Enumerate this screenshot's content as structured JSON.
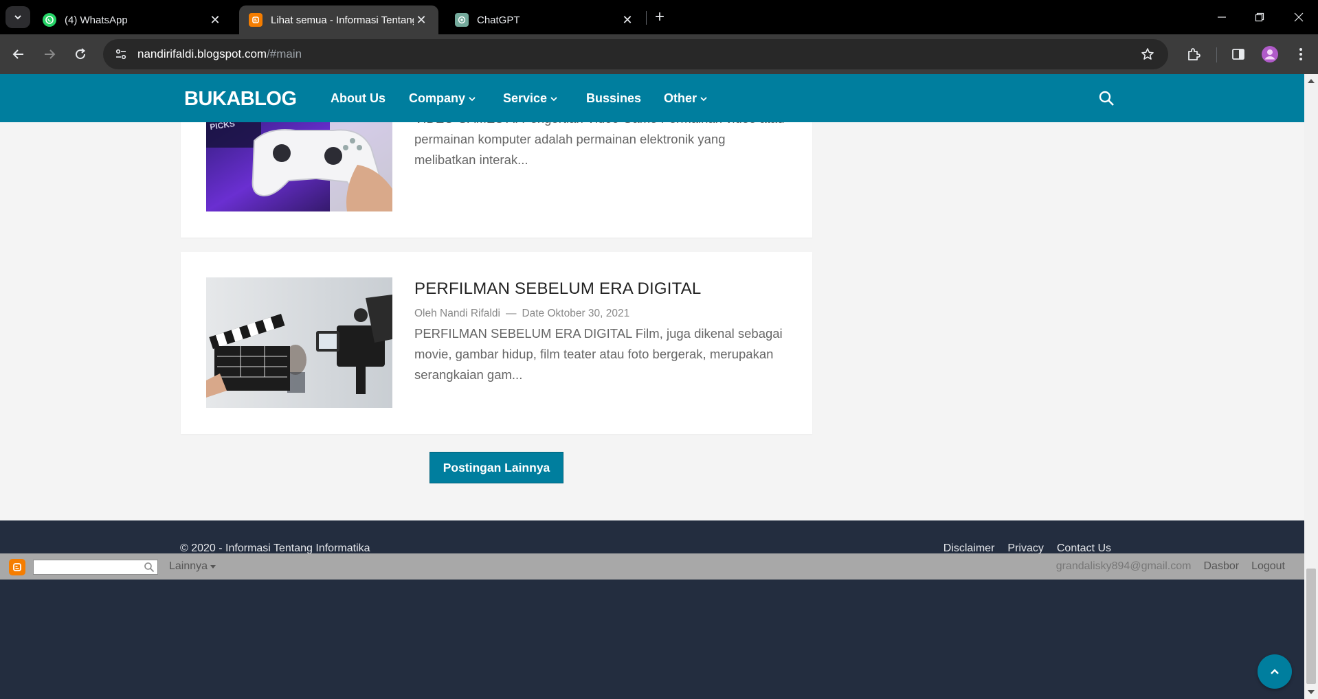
{
  "browser": {
    "tabs": [
      {
        "title": "(4) WhatsApp",
        "icon": "whatsapp-icon"
      },
      {
        "title": "Lihat semua - Informasi Tentang",
        "icon": "blogger-icon",
        "active": true
      },
      {
        "title": "ChatGPT",
        "icon": "chatgpt-icon"
      }
    ],
    "url_host": "nandirifaldi.blogspot.com",
    "url_path": "/#main"
  },
  "site": {
    "logo": "BUKABLOG",
    "nav": [
      {
        "label": "About Us",
        "dropdown": false
      },
      {
        "label": "Company",
        "dropdown": true
      },
      {
        "label": "Service",
        "dropdown": true
      },
      {
        "label": "Bussines",
        "dropdown": false
      },
      {
        "label": "Other",
        "dropdown": true
      }
    ],
    "accent_color": "#007e9e"
  },
  "posts": [
    {
      "title": "",
      "excerpt": "VIDEO GAMES   A.   Pengertian Video Game Permainan video atau permainan komputer adalah permainan elektronik yang melibatkan interak..."
    },
    {
      "title": "PERFILMAN SEBELUM ERA DIGITAL",
      "author": "Oleh Nandi Rifaldi",
      "separator": "—",
      "date": "Date Oktober 30, 2021",
      "excerpt": "PERFILMAN SEBELUM ERA DIGITAL Film, juga dikenal sebagai movie, gambar hidup, film teater atau foto bergerak, merupakan serangkaian gam..."
    }
  ],
  "more_button": "Postingan Lainnya",
  "footer": {
    "copyright": "© 2020 - Informasi Tentang Informatika",
    "links": [
      "Disclaimer",
      "Privacy",
      "Contact Us"
    ]
  },
  "blogger_bar": {
    "more_label": "Lainnya",
    "email": "grandalisky894@gmail.com",
    "dashboard": "Dasbor",
    "logout": "Logout"
  }
}
